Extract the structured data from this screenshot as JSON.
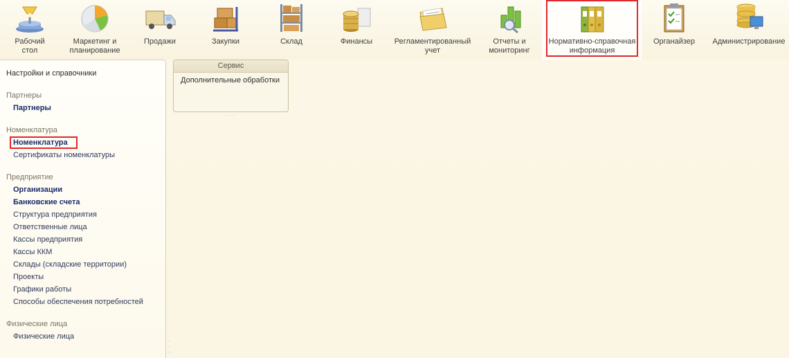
{
  "toolbar": {
    "items": [
      {
        "label": "Рабочий\nстол",
        "icon": "desktop-icon"
      },
      {
        "label": "Маркетинг и\nпланирование",
        "icon": "pie-chart-icon"
      },
      {
        "label": "Продажи",
        "icon": "truck-icon"
      },
      {
        "label": "Закупки",
        "icon": "boxes-cart-icon"
      },
      {
        "label": "Склад",
        "icon": "warehouse-shelf-icon"
      },
      {
        "label": "Финансы",
        "icon": "coins-icon"
      },
      {
        "label": "Регламентированный\nучет",
        "icon": "folder-documents-icon"
      },
      {
        "label": "Отчеты и\nмониторинг",
        "icon": "bar-chart-magnifier-icon"
      },
      {
        "label": "Нормативно-справочная\nинформация",
        "icon": "binders-icon",
        "selected": true
      },
      {
        "label": "Органайзер",
        "icon": "clipboard-icon"
      },
      {
        "label": "Администрирование",
        "icon": "database-monitor-icon"
      }
    ]
  },
  "left_panel": {
    "top_link": "Настройки и справочники",
    "sections": [
      {
        "title": "Партнеры",
        "items": [
          {
            "label": "Партнеры",
            "bold": true
          }
        ]
      },
      {
        "title": "Номенклатура",
        "items": [
          {
            "label": "Номенклатура",
            "bold": true,
            "highlighted": true
          },
          {
            "label": "Сертификаты номенклатуры"
          }
        ]
      },
      {
        "title": "Предприятие",
        "items": [
          {
            "label": "Организации",
            "bold": true
          },
          {
            "label": "Банковские счета",
            "bold": true
          },
          {
            "label": "Структура предприятия"
          },
          {
            "label": "Ответственные лица"
          },
          {
            "label": "Кассы предприятия"
          },
          {
            "label": "Кассы ККМ"
          },
          {
            "label": "Склады (складские территории)"
          },
          {
            "label": "Проекты"
          },
          {
            "label": "Графики работы"
          },
          {
            "label": "Способы обеспечения потребностей"
          }
        ]
      },
      {
        "title": "Физические лица",
        "items": [
          {
            "label": "Физические лица"
          }
        ]
      }
    ]
  },
  "service": {
    "title": "Сервис",
    "link": "Дополнительные обработки"
  },
  "colors": {
    "highlight_border": "#e0282a",
    "bold_link": "#1a2c6b",
    "section_title": "#7b7565",
    "background": "#fbf6e6"
  }
}
